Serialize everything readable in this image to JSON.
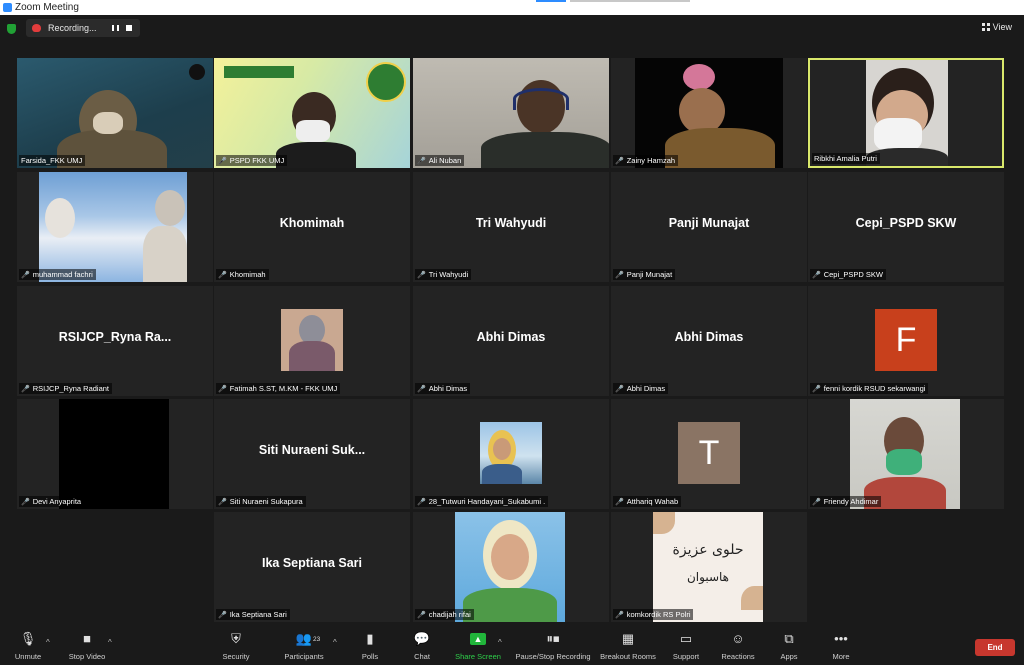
{
  "window": {
    "title": "Zoom Meeting"
  },
  "recording": {
    "label": "Recording..."
  },
  "view_button": {
    "label": "View"
  },
  "participants": [
    {
      "name": "Farsida_FKK UMJ",
      "muted": false
    },
    {
      "name": "PSPD FKK UMJ",
      "muted": true
    },
    {
      "name": "Ali Nuban",
      "muted": true
    },
    {
      "name": "Zainy Hamzah",
      "muted": true
    },
    {
      "name": "Ribkhi Amalia Putri",
      "muted": false
    },
    {
      "name": "muhammad fachri",
      "muted": true
    },
    {
      "name": "Khomimah",
      "muted": true,
      "display": "Khomimah"
    },
    {
      "name": "Tri Wahyudi",
      "muted": true,
      "display": "Tri Wahyudi"
    },
    {
      "name": "Panji Munajat",
      "muted": true,
      "display": "Panji Munajat"
    },
    {
      "name": "Cepi_PSPD SKW",
      "muted": true,
      "display": "Cepi_PSPD SKW"
    },
    {
      "name": "RSIJCP_Ryna Radiant",
      "muted": true,
      "display": "RSIJCP_Ryna  Ra..."
    },
    {
      "name": "Fatimah S.ST, M.KM - FKK UMJ",
      "muted": true
    },
    {
      "name": "Abhi Dimas",
      "muted": true,
      "display": "Abhi Dimas"
    },
    {
      "name": "Abhi Dimas",
      "muted": true,
      "display": "Abhi Dimas"
    },
    {
      "name": "fenni kordik RSUD sekarwangi",
      "muted": true,
      "avatar_letter": "F"
    },
    {
      "name": "Devi Anyaprita",
      "muted": true
    },
    {
      "name": "Siti Nuraeni Sukapura",
      "muted": true,
      "display": "Siti  Nuraeni  Suk..."
    },
    {
      "name": "28_Tutwuri Handayani_Sukabumi .",
      "muted": true
    },
    {
      "name": "Atthariq Wahab",
      "muted": true,
      "avatar_letter": "T"
    },
    {
      "name": "Friendy Ahdimar",
      "muted": true
    },
    {
      "name": "Ika Septiana Sari",
      "muted": true,
      "display": "Ika Septiana Sari"
    },
    {
      "name": "chadijah rifai",
      "muted": true
    },
    {
      "name": "komkordik RS Polri",
      "muted": true,
      "image_text": [
        "حلوى عزيزة",
        "هاسبوان"
      ]
    }
  ],
  "toolbar": {
    "unmute": "Unmute",
    "stop_video": "Stop Video",
    "security": "Security",
    "participants": "Participants",
    "participants_count": "23",
    "polls": "Polls",
    "chat": "Chat",
    "share_screen": "Share Screen",
    "pause_recording": "Pause/Stop Recording",
    "breakout_rooms": "Breakout Rooms",
    "support": "Support",
    "reactions": "Reactions",
    "apps": "Apps",
    "more": "More",
    "end": "End"
  },
  "colors": {
    "background": "#1a1a1a",
    "tile": "#232323",
    "active_speaker": "#d9e86b",
    "muted_mic": "#e5413a",
    "end_button": "#c7372e",
    "share_green": "#21b63b"
  }
}
